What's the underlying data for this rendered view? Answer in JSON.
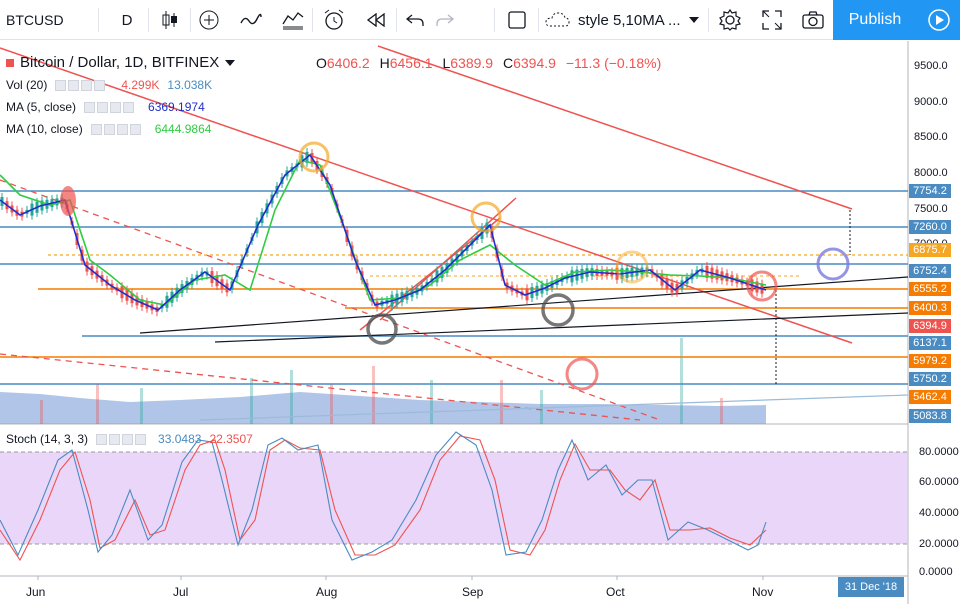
{
  "toolbar": {
    "symbol": "BTCUSD",
    "interval": "D",
    "style_label": "style 5,10MA ...",
    "publish_label": "Publish"
  },
  "chart": {
    "title": "Bitcoin / Dollar, 1D, BITFINEX",
    "ohlc": {
      "o_label": "O",
      "o": "6406.2",
      "h_label": "H",
      "h": "6456.1",
      "l_label": "L",
      "l": "6389.9",
      "c_label": "C",
      "c": "6394.9",
      "change": "−11.3 (−0.18%)"
    },
    "indicators": {
      "vol": {
        "name": "Vol (20)",
        "v1": "4.299K",
        "v2": "13.038K"
      },
      "ma5": {
        "name": "MA (5, close)",
        "value": "6369.1974"
      },
      "ma10": {
        "name": "MA (10, close)",
        "value": "6444.9864"
      }
    },
    "stoch": {
      "name": "Stoch (14, 3, 3)",
      "k": "33.0483",
      "d": "22.3507"
    },
    "price_axis": [
      "9500.0",
      "9000.0",
      "8500.0",
      "8000.0",
      "7500.0",
      "7000.0"
    ],
    "price_labels": [
      {
        "text": "7754.2",
        "color": "#4a8bc2"
      },
      {
        "text": "7260.0",
        "color": "#4a8bc2"
      },
      {
        "text": "6875.7",
        "color": "#f5a623"
      },
      {
        "text": "6752.4",
        "color": "#4a8bc2"
      },
      {
        "text": "6555.2",
        "color": "#f57c00"
      },
      {
        "text": "6400.3",
        "color": "#f57c00"
      },
      {
        "text": "6394.9",
        "color": "#ef5350"
      },
      {
        "text": "6137.1",
        "color": "#4a8bc2"
      },
      {
        "text": "5979.2",
        "color": "#f57c00"
      },
      {
        "text": "5750.2",
        "color": "#4a8bc2"
      },
      {
        "text": "5462.4",
        "color": "#f57c00"
      },
      {
        "text": "5083.8",
        "color": "#4a8bc2"
      }
    ],
    "stoch_axis": [
      "80.0000",
      "60.0000",
      "40.0000",
      "20.0000",
      "0.0000"
    ],
    "x_axis": [
      "Jun",
      "Jul",
      "Aug",
      "Sep",
      "Oct",
      "Nov"
    ],
    "date_badge": "31 Dec '18"
  }
}
